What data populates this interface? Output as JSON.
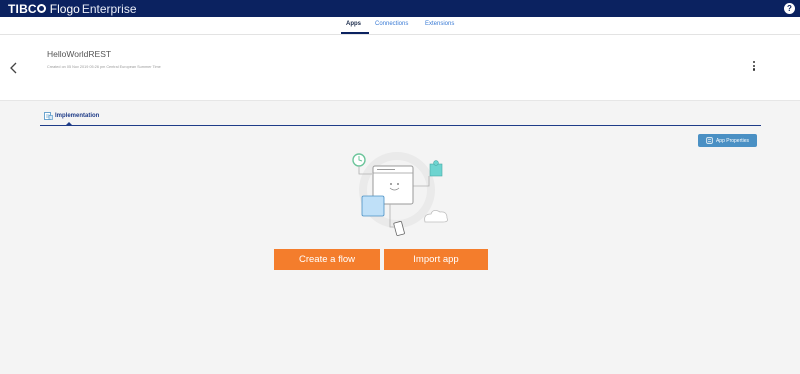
{
  "brand": {
    "tibco": "TIBC",
    "flogo": "Flogo",
    "edition": "Enterprise",
    "help": "?"
  },
  "nav": {
    "tabs": [
      {
        "label": "Apps"
      },
      {
        "label": "Connections"
      },
      {
        "label": "Extensions"
      }
    ],
    "active": "Apps"
  },
  "app": {
    "name": "HelloWorldREST",
    "subtitle": "Created on 05 Nov 2019 05:26 pm Central European Summer Time"
  },
  "tabs": {
    "implementation": "Implementation"
  },
  "toolbar": {
    "app_properties": "App Properties"
  },
  "actions": {
    "create_flow": "Create a flow",
    "import_app": "Import app"
  },
  "colors": {
    "brand_bar": "#0b2260",
    "accent": "#f47d2c",
    "link": "#3a7bd5",
    "button_blue": "#4a90c4"
  }
}
